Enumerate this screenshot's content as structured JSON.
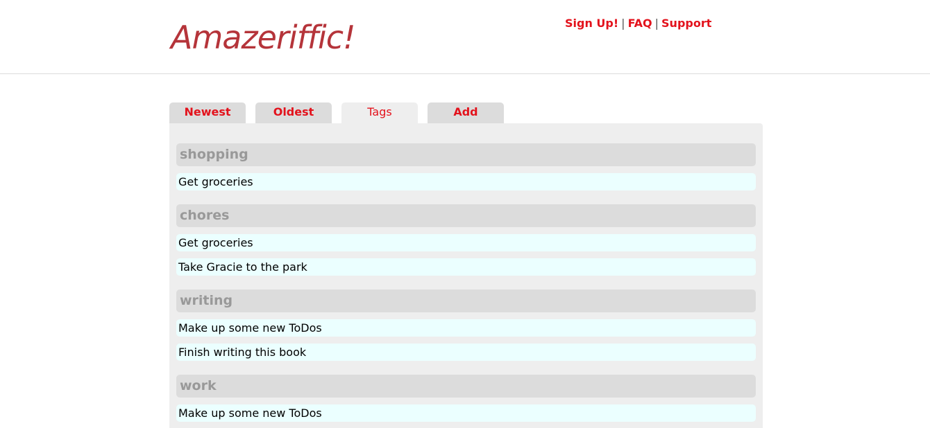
{
  "header": {
    "logo": "Amazeriffic!",
    "nav": {
      "signup": "Sign Up!",
      "separator": "|",
      "faq": "FAQ",
      "support": "Support"
    }
  },
  "tabs": [
    {
      "label": "Newest",
      "active": false
    },
    {
      "label": "Oldest",
      "active": false
    },
    {
      "label": "Tags",
      "active": true
    },
    {
      "label": "Add",
      "active": false
    }
  ],
  "tag_groups": [
    {
      "name": "shopping",
      "todos": [
        "Get groceries"
      ]
    },
    {
      "name": "chores",
      "todos": [
        "Get groceries",
        "Take Gracie to the park"
      ]
    },
    {
      "name": "writing",
      "todos": [
        "Make up some new ToDos",
        "Finish writing this book"
      ]
    },
    {
      "name": "work",
      "todos": [
        "Make up some new ToDos"
      ]
    }
  ],
  "colors": {
    "logo": "#b5343a",
    "link": "#e3121c",
    "tab_bg": "#dcdcdc",
    "panel_bg": "#eeeeee",
    "tag_text": "#999999",
    "todo_bg": "#ebffff"
  }
}
